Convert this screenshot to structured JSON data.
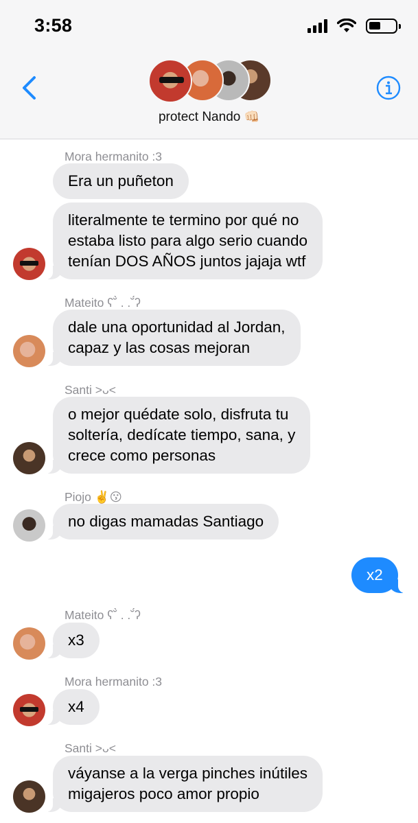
{
  "status_bar": {
    "time": "3:58"
  },
  "header": {
    "group_name": "protect Nando",
    "group_emoji": "👊🏻"
  },
  "colors": {
    "outgoing_bubble": "#1e8bff",
    "incoming_bubble": "#e9e9eb",
    "accent": "#1e8bff"
  },
  "messages": [
    {
      "sender": "Mora hermanito :3",
      "text": "Era un puñeton"
    },
    {
      "text": "literalmente te termino por qué no\nestaba listo para algo serio cuando\ntenían DOS AÑOS juntos jajaja wtf"
    },
    {
      "sender": "Mateito ʕ˘̀ . .˘́ʔ",
      "text": "dale una oportunidad al Jordan,\ncapaz y las cosas mejoran"
    },
    {
      "sender": "Santi >ᴗ<",
      "text": "o mejor quédate solo, disfruta tu\nsoltería, dedícate tiempo, sana, y\ncrece como personas"
    },
    {
      "sender": "Piojo ✌️😗",
      "text": "no digas mamadas Santiago"
    },
    {
      "text": "x2"
    },
    {
      "sender": "Mateito ʕ˘̀ . .˘́ʔ",
      "text": "x3"
    },
    {
      "sender": "Mora hermanito :3",
      "text": "x4"
    },
    {
      "sender": "Santi >ᴗ<",
      "text": "váyanse a la verga pinches inútiles\nmigajeros poco amor propio"
    }
  ]
}
